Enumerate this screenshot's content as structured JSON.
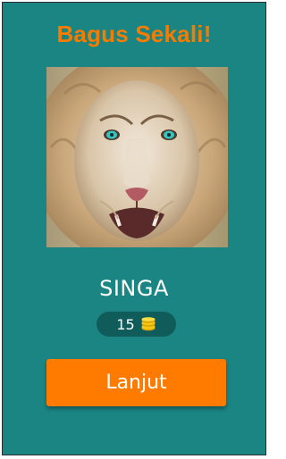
{
  "header": {
    "title": "Bagus Sekali!"
  },
  "puzzle": {
    "image_icon": "lion-photo",
    "answer": "SINGA"
  },
  "reward": {
    "coins": "15",
    "icon": "coin-stack-icon"
  },
  "actions": {
    "next_label": "Lanjut"
  },
  "colors": {
    "background": "#1b8583",
    "title": "#f57c00",
    "button": "#ff7b00",
    "pill": "#0f5c5b",
    "coin": "#f5c518"
  }
}
